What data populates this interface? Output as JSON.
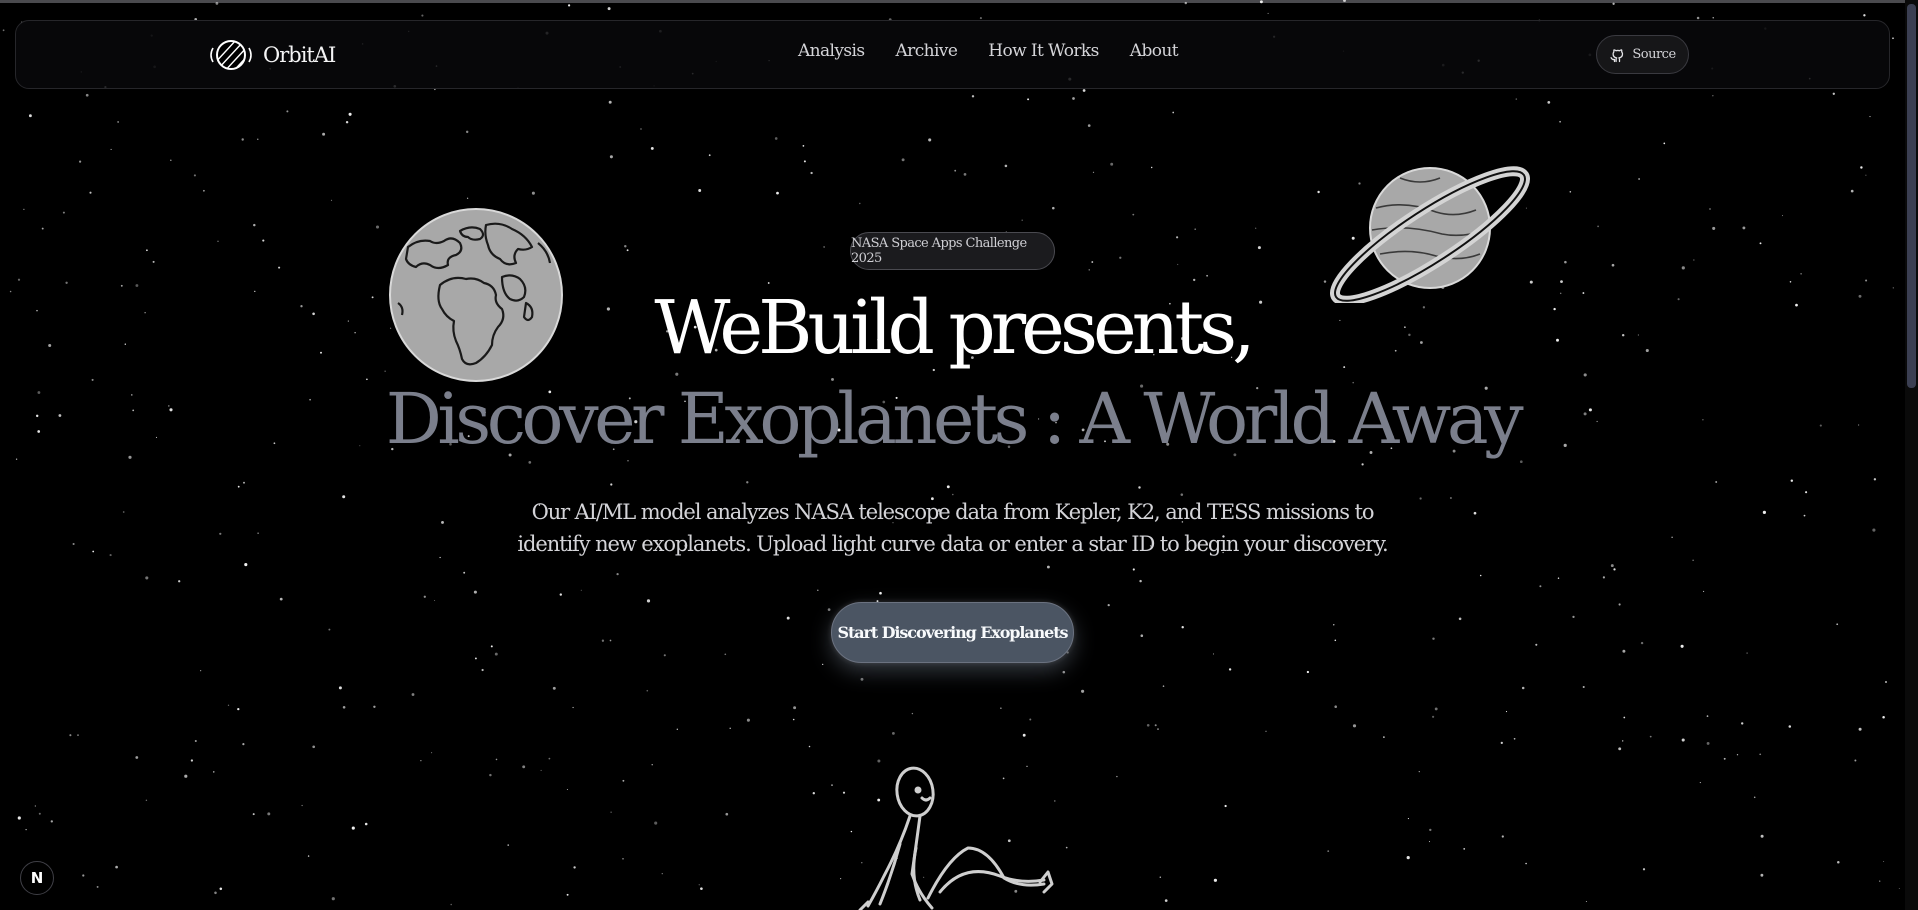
{
  "navbar": {
    "brand": "OrbitAI",
    "links": [
      "Analysis",
      "Archive",
      "How It Works",
      "About"
    ],
    "source_label": "Source"
  },
  "hero": {
    "badge": "NASA Space Apps Challenge 2025",
    "title": "WeBuild presents,",
    "subtitle": "Discover Exoplanets : A World Away",
    "description_line1": "Our AI/ML model analyzes NASA telescope data from Kepler, K2, and TESS missions to",
    "description_line2": "identify new exoplanets. Upload light curve data or enter a star ID to begin your discovery.",
    "cta": "Start Discovering Exoplanets"
  },
  "dev_badge": "N",
  "colors": {
    "background": "#000000",
    "subtitle": "#7b7f8c",
    "cta_bg": "#4b5563",
    "scrollbar": "#3b3f52"
  },
  "icons": [
    "orbit-logo-icon",
    "github-icon",
    "earth-illustration",
    "saturn-illustration",
    "astronaut-illustration",
    "nextjs-icon"
  ]
}
